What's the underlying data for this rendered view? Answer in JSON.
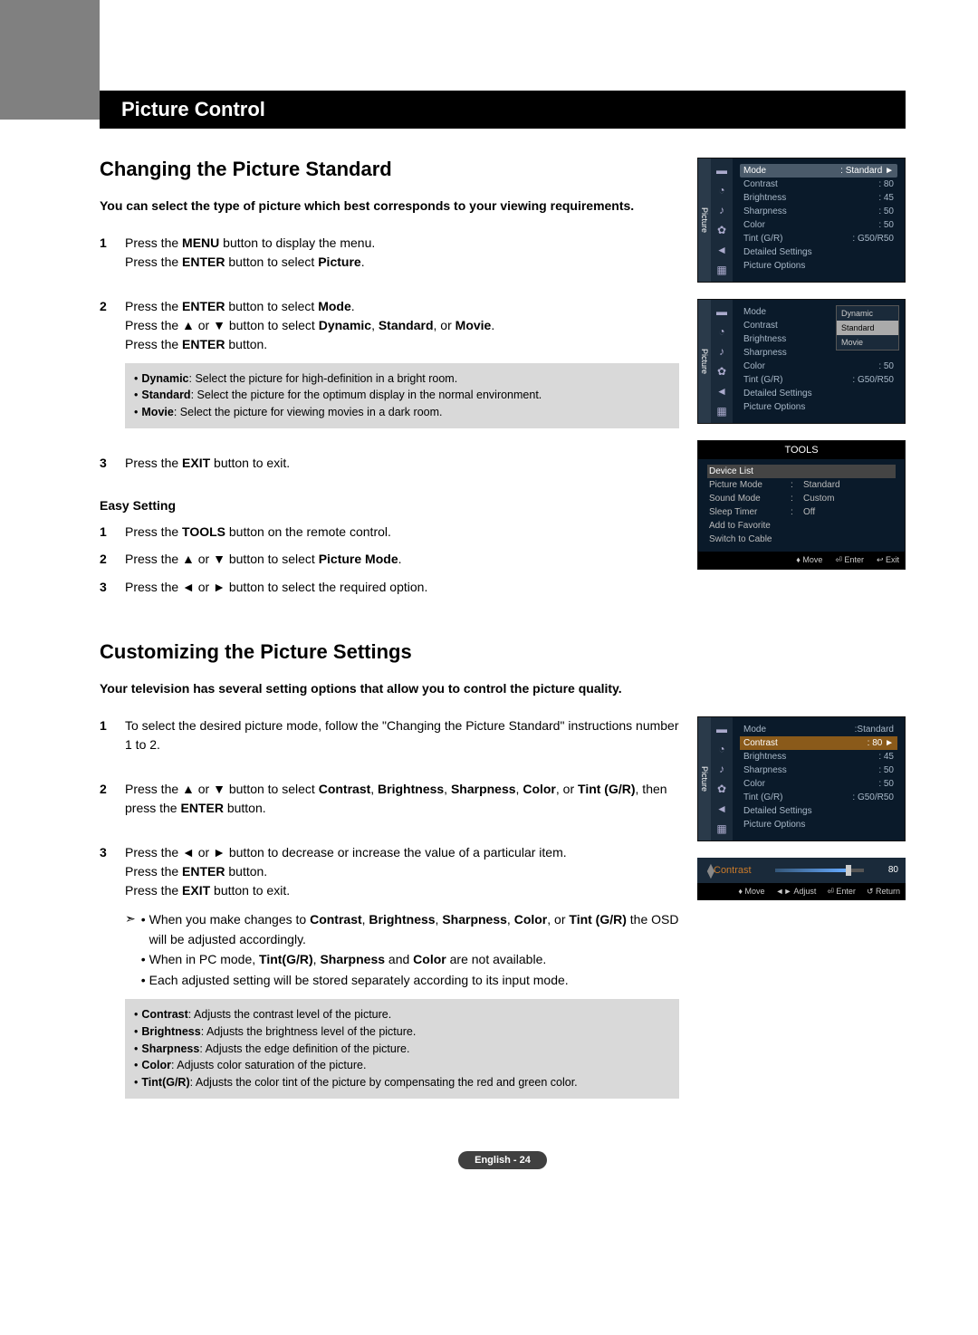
{
  "header": "Picture Control",
  "s1": {
    "title": "Changing the Picture Standard",
    "intro": "You can select the type of picture which best corresponds to your viewing requirements.",
    "steps": [
      {
        "n": "1",
        "lines": [
          "Press the <b>MENU</b> button to display the menu.",
          "Press the <b>ENTER</b> button to select <b>Picture</b>."
        ]
      },
      {
        "n": "2",
        "lines": [
          "Press the <b>ENTER</b> button to select <b>Mode</b>.",
          "Press the ▲ or ▼ button to select <b>Dynamic</b>, <b>Standard</b>, or <b>Movie</b>.",
          "Press the <b>ENTER</b> button."
        ],
        "box": [
          "<b>Dynamic</b>: Select the picture for high-definition in a bright room.",
          "<b>Standard</b>: Select the picture for the optimum display in the normal environment.",
          "<b>Movie</b>: Select the picture for viewing movies in a dark room."
        ]
      },
      {
        "n": "3",
        "lines": [
          "Press the <b>EXIT</b> button to exit."
        ]
      }
    ],
    "easy_title": "Easy Setting",
    "easy": [
      {
        "n": "1",
        "t": "Press the <b>TOOLS</b> button on the remote control."
      },
      {
        "n": "2",
        "t": "Press the ▲ or ▼ button to select <b>Picture Mode</b>."
      },
      {
        "n": "3",
        "t": "Press the ◄ or ► button to select the required option."
      }
    ]
  },
  "s2": {
    "title": "Customizing the Picture Settings",
    "intro": "Your television has several setting options that allow you to control the picture quality.",
    "steps": [
      {
        "n": "1",
        "lines": [
          "To select the desired picture mode, follow the \"Changing the Picture Standard\" instructions number 1 to 2."
        ]
      },
      {
        "n": "2",
        "lines": [
          "Press the ▲ or ▼ button to select <b>Contrast</b>, <b>Brightness</b>, <b>Sharpness</b>, <b>Color</b>, or <b>Tint (G/R)</b>, then press the <b>ENTER</b> button."
        ]
      },
      {
        "n": "3",
        "lines": [
          "Press the ◄ or ► button to decrease or increase the value of a particular item.",
          "Press the <b>ENTER</b> button.",
          "Press the <b>EXIT</b> button to exit."
        ],
        "notes": [
          "When you make changes to <b>Contrast</b>, <b>Brightness</b>, <b>Sharpness</b>, <b>Color</b>, or <b>Tint (G/R)</b> the OSD will be adjusted accordingly.",
          "When in PC mode, <b>Tint(G/R)</b>, <b>Sharpness</b> and <b>Color</b> are not available.",
          "Each adjusted setting will be stored separately according to its input mode."
        ],
        "box": [
          "<b>Contrast</b>: Adjusts the contrast level of the picture.",
          "<b>Brightness</b>: Adjusts the brightness level of the picture.",
          "<b>Sharpness</b>: Adjusts the edge definition of the picture.",
          "<b>Color</b>: Adjusts color saturation of the picture.",
          "<b>Tint(G/R)</b>: Adjusts the color tint of the picture by compensating the red and green color."
        ]
      }
    ]
  },
  "osd1": {
    "label": "Picture",
    "rows": [
      {
        "k": "Mode",
        "v": ": Standard",
        "sel": true,
        "arrow": "►"
      },
      {
        "k": "Contrast",
        "v": ": 80"
      },
      {
        "k": "Brightness",
        "v": ": 45"
      },
      {
        "k": "Sharpness",
        "v": ": 50"
      },
      {
        "k": "Color",
        "v": ": 50"
      },
      {
        "k": "Tint (G/R)",
        "v": ": G50/R50"
      },
      {
        "k": "Detailed Settings",
        "v": ""
      },
      {
        "k": "Picture Options",
        "v": ""
      }
    ]
  },
  "osd2": {
    "label": "Picture",
    "rows": [
      {
        "k": "Mode",
        "v": ""
      },
      {
        "k": "Contrast",
        "v": ""
      },
      {
        "k": "Brightness",
        "v": ""
      },
      {
        "k": "Sharpness",
        "v": ""
      },
      {
        "k": "Color",
        "v": ": 50"
      },
      {
        "k": "Tint (G/R)",
        "v": ": G50/R50"
      },
      {
        "k": "Detailed Settings",
        "v": ""
      },
      {
        "k": "Picture Options",
        "v": ""
      }
    ],
    "dropdown": [
      "Dynamic",
      "Standard",
      "Movie"
    ],
    "ddsel": 1
  },
  "tools": {
    "title": "TOOLS",
    "rows": [
      {
        "k": "Device List",
        "v": "",
        "sel": true
      },
      {
        "k": "Picture Mode",
        "c": ":",
        "v": "Standard"
      },
      {
        "k": "Sound Mode",
        "c": ":",
        "v": "Custom"
      },
      {
        "k": "Sleep Timer",
        "c": ":",
        "v": "Off"
      },
      {
        "k": "Add to Favorite",
        "v": ""
      },
      {
        "k": "Switch to Cable",
        "v": ""
      }
    ],
    "hints": [
      "♦ Move",
      "⏎ Enter",
      "↩ Exit"
    ]
  },
  "osd3": {
    "label": "Picture",
    "rows": [
      {
        "k": "Mode",
        "v": ":Standard"
      },
      {
        "k": "Contrast",
        "v": ": 80",
        "hl": true,
        "arrow": "►"
      },
      {
        "k": "Brightness",
        "v": ": 45"
      },
      {
        "k": "Sharpness",
        "v": ": 50"
      },
      {
        "k": "Color",
        "v": ": 50"
      },
      {
        "k": "Tint (G/R)",
        "v": ": G50/R50"
      },
      {
        "k": "Detailed Settings",
        "v": ""
      },
      {
        "k": "Picture Options",
        "v": ""
      }
    ]
  },
  "slider": {
    "label": "Contrast",
    "value": "80",
    "hints": [
      "♦ Move",
      "◄► Adjust",
      "⏎ Enter",
      "↺ Return"
    ]
  },
  "footer": "English - 24"
}
